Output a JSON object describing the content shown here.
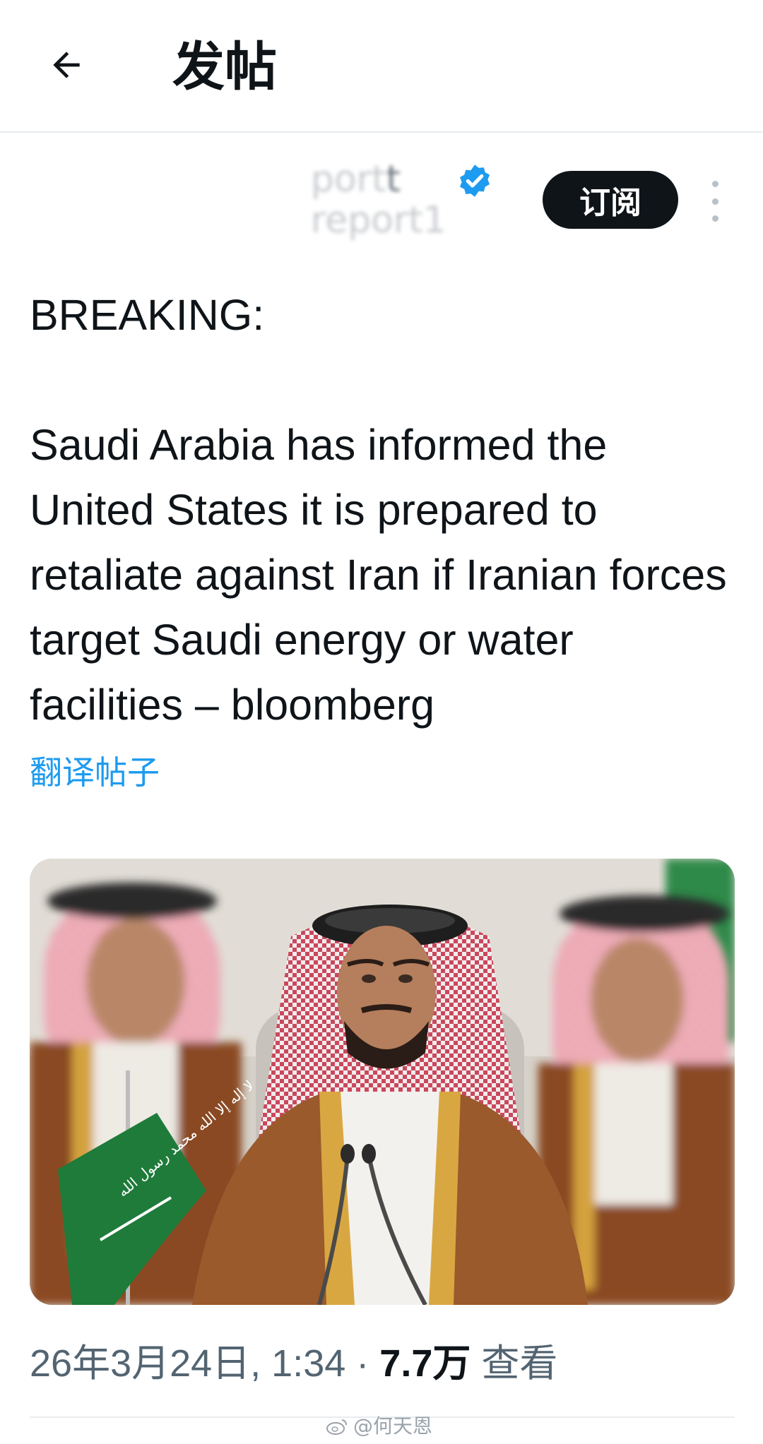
{
  "header": {
    "title": "发帖",
    "back_icon": "arrow-left-icon"
  },
  "author": {
    "name_visible": "port",
    "name_suffix": "t",
    "handle_visible": "report1",
    "verified_icon": "verified-badge-icon",
    "verified_color": "#1d9bf0",
    "subscribe_label": "订阅",
    "more_icon": "more-vertical-icon"
  },
  "tweet": {
    "heading": "BREAKING:",
    "body": "Saudi Arabia has informed the United States it is prepared to retaliate against Iran if Iranian forces target Saudi energy or water facilities – bloomberg",
    "translate_label": "翻译帖子",
    "link_color": "#1d9bf0"
  },
  "media": {
    "flag_script": "لا إله إلا الله محمد رسول الله"
  },
  "meta": {
    "timestamp": "26年3月24日, 1:34",
    "separator": "·",
    "views_count": "7.7万",
    "views_label": "查看"
  },
  "watermark": {
    "text": "@何天恩"
  }
}
